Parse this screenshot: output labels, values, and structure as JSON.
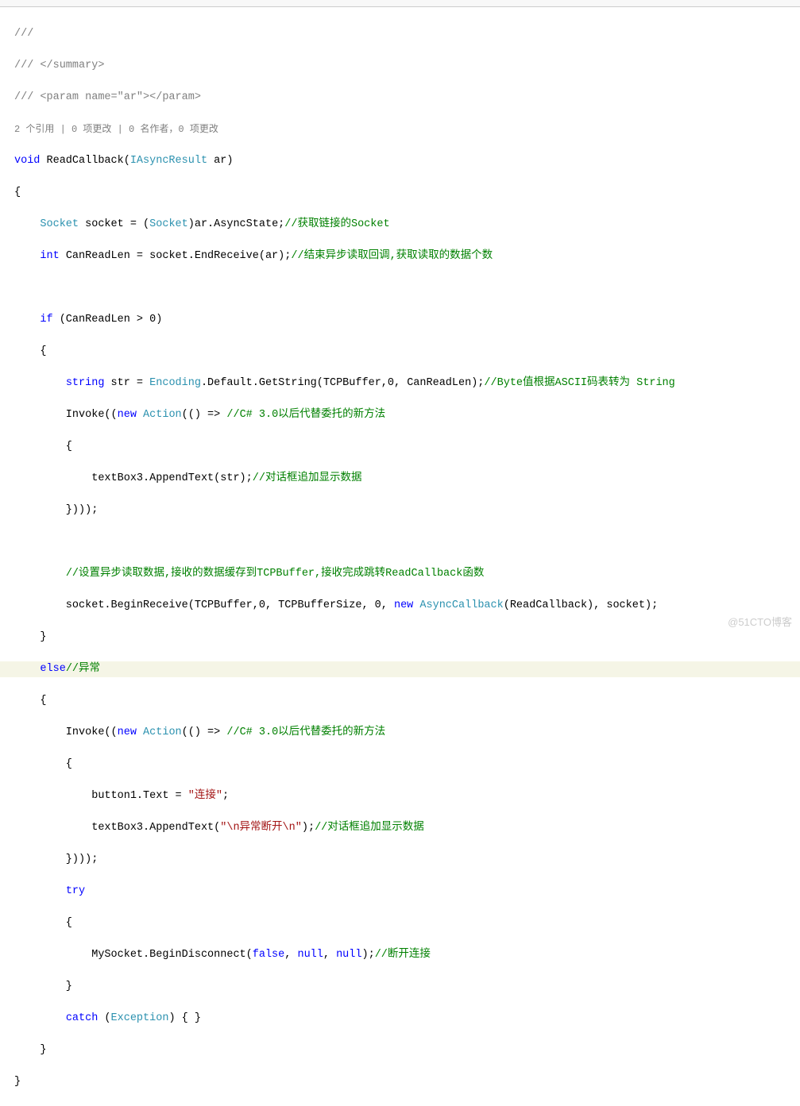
{
  "watermark": "@51CTO博客",
  "lines": {
    "l1": "///",
    "l2a": "/// ",
    "l2b": "</summary>",
    "l3a": "/// ",
    "l3b": "<param name=",
    "l3c": "\"ar\"",
    "l3d": "></param>",
    "codelens": "2 个引用 | 0 项更改 | 0 名作者，0 项更改",
    "l4a": "void",
    "l4b": " ReadCallback(",
    "l4c": "IAsyncResult",
    "l4d": " ar)",
    "l5": "{",
    "l6a": "    ",
    "l6b": "Socket",
    "l6c": " socket = (",
    "l6d": "Socket",
    "l6e": ")ar.AsyncState;",
    "l6f": "//获取链接的Socket",
    "l7a": "    ",
    "l7b": "int",
    "l7c": " CanReadLen = socket.EndReceive(ar);",
    "l7d": "//结束异步读取回调,获取读取的数据个数",
    "blank": " ",
    "l8a": "    ",
    "l8b": "if",
    "l8c": " (CanReadLen > 0)",
    "l9": "    {",
    "l10a": "        ",
    "l10b": "string",
    "l10c": " str = ",
    "l10d": "Encoding",
    "l10e": ".Default.GetString(TCPBuffer,0, CanReadLen);",
    "l10f": "//Byte值根据ASCII码表转为 String",
    "l11a": "        Invoke((",
    "l11b": "new",
    "l11c": " ",
    "l11d": "Action",
    "l11e": "(() => ",
    "l11f": "//C# 3.0以后代替委托的新方法",
    "l12": "        {",
    "l13a": "            textBox3.AppendText(str);",
    "l13b": "//对话框追加显示数据",
    "l14": "        })));",
    "l15a": "        ",
    "l15b": "//设置异步读取数据,接收的数据缓存到TCPBuffer,接收完成跳转ReadCallback函数",
    "l16a": "        socket.BeginReceive(TCPBuffer,0, TCPBufferSize, 0, ",
    "l16b": "new",
    "l16c": " ",
    "l16d": "AsyncCallback",
    "l16e": "(ReadCallback), socket);",
    "l17": "    }",
    "l18a": "    ",
    "l18b": "else",
    "l18c": "//异常",
    "l19": "    {",
    "l20a": "        Invoke((",
    "l20b": "new",
    "l20c": " ",
    "l20d": "Action",
    "l20e": "(() => ",
    "l20f": "//C# 3.0以后代替委托的新方法",
    "l21": "        {",
    "l22a": "            button1.Text = ",
    "l22b": "\"连接\"",
    "l22c": ";",
    "l23a": "            textBox3.AppendText(",
    "l23b": "\"\\n异常断开\\n\"",
    "l23c": ");",
    "l23d": "//对话框追加显示数据",
    "l24": "        })));",
    "l25a": "        ",
    "l25b": "try",
    "l26": "        {",
    "l27a": "            MySocket.BeginDisconnect(",
    "l27b": "false",
    "l27c": ", ",
    "l27d": "null",
    "l27e": ", ",
    "l27f": "null",
    "l27g": ");",
    "l27h": "//断开连接",
    "l28": "        }",
    "l29a": "        ",
    "l29b": "catch",
    "l29c": " (",
    "l29d": "Exception",
    "l29e": ") { }",
    "l30": "    }",
    "l31": "}"
  }
}
